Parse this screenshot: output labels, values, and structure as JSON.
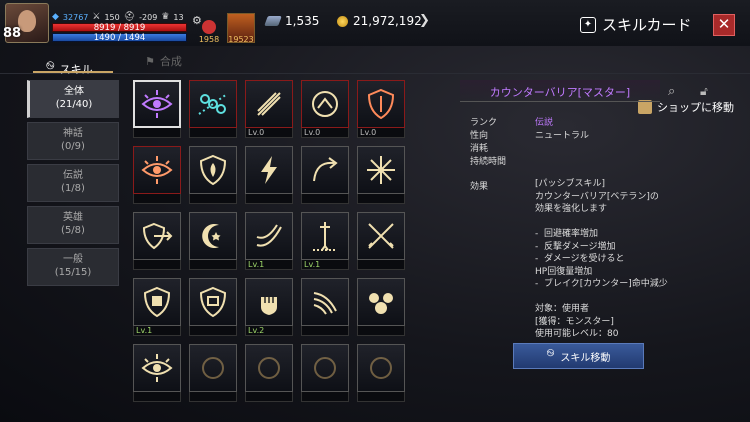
{
  "player": {
    "level": "88",
    "power": "32767",
    "stat1": "150",
    "stat2": "-209",
    "stat3": "13",
    "hp": "8919 / 8919",
    "hp_fraction": 1.0,
    "mp": "1490 / 1494",
    "mp_fraction": 0.997
  },
  "items": {
    "potion_count": "1958",
    "buff_count": "19523"
  },
  "currency": {
    "gems": "1,535",
    "gold": "21,972,192"
  },
  "header": {
    "title": "スキルカード",
    "close_label": "✕"
  },
  "tabs": [
    {
      "label": "スキル"
    },
    {
      "label": "合成"
    }
  ],
  "shop_label": "ショップに移動",
  "sidebar": [
    {
      "label": "全体",
      "count": "(21/40)"
    },
    {
      "label": "神話",
      "count": "(0/9)"
    },
    {
      "label": "伝説",
      "count": "(1/8)"
    },
    {
      "label": "英雄",
      "count": "(5/8)"
    },
    {
      "label": "一般",
      "count": "(15/15)"
    }
  ],
  "cards": [
    {
      "icon": "eye-icon",
      "level": "",
      "rarity": "legend",
      "color": "#c07aff"
    },
    {
      "icon": "chain-icon",
      "level": "",
      "rarity": "legend",
      "color": "#5ee0e0"
    },
    {
      "icon": "sword-slash-icon",
      "level": "Lv.0",
      "rarity": "legend",
      "color": "#f0e0b0"
    },
    {
      "icon": "up-arrow-circle-icon",
      "level": "Lv.0",
      "rarity": "legend",
      "color": "#f0e0b0"
    },
    {
      "icon": "shield-icon",
      "level": "Lv.0",
      "rarity": "legend",
      "color": "#ff8a5a"
    },
    {
      "icon": "eye-icon",
      "level": "",
      "rarity": "legend",
      "color": "#ff9a6a"
    },
    {
      "icon": "shield-flame-icon",
      "level": "",
      "rarity": "normal",
      "color": "#f0e0b0"
    },
    {
      "icon": "lightning-icon",
      "level": "",
      "rarity": "normal",
      "color": "#f0e0b0"
    },
    {
      "icon": "curve-arrow-icon",
      "level": "",
      "rarity": "normal",
      "color": "#f0e0b0"
    },
    {
      "icon": "burst-icon",
      "level": "",
      "rarity": "normal",
      "color": "#f0e0b0"
    },
    {
      "icon": "shield-arrow-icon",
      "level": "",
      "rarity": "normal",
      "color": "#f0e0b0"
    },
    {
      "icon": "crescent-star-icon",
      "level": "",
      "rarity": "normal",
      "color": "#f0e0b0"
    },
    {
      "icon": "slash-icon",
      "level": "Lv.1",
      "rarity": "normal",
      "color": "#f0e0b0"
    },
    {
      "icon": "sword-down-icon",
      "level": "Lv.1",
      "rarity": "normal",
      "color": "#f0e0b0"
    },
    {
      "icon": "crossed-swords-icon",
      "level": "",
      "rarity": "normal",
      "color": "#f0e0b0"
    },
    {
      "icon": "shield-armor-icon",
      "level": "Lv.1",
      "rarity": "normal",
      "color": "#f0e0b0"
    },
    {
      "icon": "shield-fist-icon",
      "level": "",
      "rarity": "normal",
      "color": "#f0e0b0"
    },
    {
      "icon": "fist-icon",
      "level": "Lv.2",
      "rarity": "normal",
      "color": "#f0e0b0"
    },
    {
      "icon": "claw-slash-icon",
      "level": "",
      "rarity": "normal",
      "color": "#f0e0b0"
    },
    {
      "icon": "skulls-icon",
      "level": "",
      "rarity": "normal",
      "color": "#f0e0b0"
    },
    {
      "icon": "eye-icon",
      "level": "",
      "rarity": "normal",
      "color": "#f0e0b0"
    },
    {
      "icon": "blank-icon",
      "level": "",
      "rarity": "normal",
      "color": "#c9a565"
    },
    {
      "icon": "blank-icon",
      "level": "",
      "rarity": "normal",
      "color": "#c9a565"
    },
    {
      "icon": "blank-icon",
      "level": "",
      "rarity": "normal",
      "color": "#c9a565"
    },
    {
      "icon": "blank-icon",
      "level": "",
      "rarity": "normal",
      "color": "#c9a565"
    }
  ],
  "detail": {
    "name": "カウンターバリア[マスター]",
    "rank_label": "ランク",
    "rank_value": "伝説",
    "attr_label": "性向",
    "attr_value": "ニュートラル",
    "cost_label": "消耗",
    "duration_label": "持続時間",
    "effect_label": "効果",
    "effect_text": "[パッシブスキル]\nカウンターバリア[ベテラン]の\n効果を強化します\n\n-  回避確率増加\n-  反撃ダメージ増加\n-  ダメージを受けると\nHP回復量増加\n-  ブレイク[カウンター]命中減少\n\n対象：使用者\n[獲得：モンスター]\n使用可能レベル：80",
    "move_label": "スキル移動"
  }
}
